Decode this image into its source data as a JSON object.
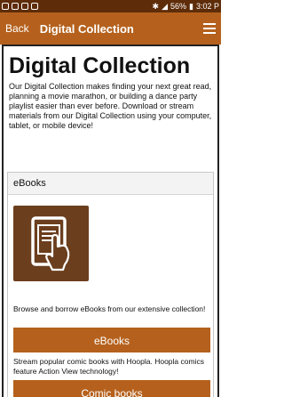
{
  "status_bar": {
    "battery": "56%",
    "time": "3:02 P"
  },
  "app_bar": {
    "back_label": "Back",
    "title": "Digital Collection",
    "menu_icon": "hamburger-menu-icon"
  },
  "page": {
    "title": "Digital Collection",
    "intro": "Our Digital Collection makes finding your next great read, planning a movie marathon, or building a dance party playlist easier than ever before. Download or stream materials from our Digital Collection using your computer, tablet, or mobile device!"
  },
  "ebooks_card": {
    "heading": "eBooks",
    "icon": "tablet-touch-icon",
    "ebooks_desc": "Browse and borrow eBooks from our extensive collection!",
    "ebooks_button": "eBooks",
    "comics_desc": "Stream popular comic books with Hoopla. Hoopla comics feature Action View technology!",
    "comics_button": "Comic books"
  },
  "colors": {
    "status_bar": "#5e2c09",
    "app_bar": "#b5611d",
    "button": "#b5611d",
    "icon_tile": "#6b3e1e"
  }
}
